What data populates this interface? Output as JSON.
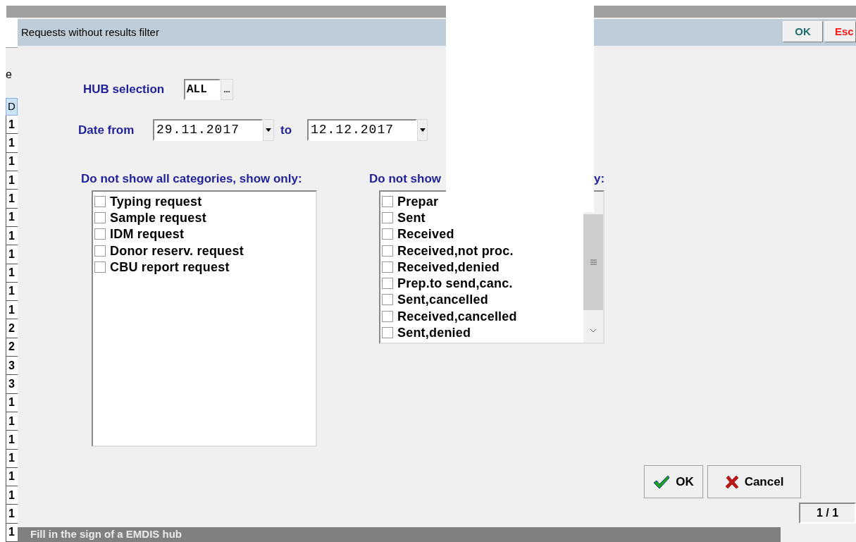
{
  "background": {
    "column_header_fragment": "e",
    "table_header": "D",
    "table_cells": [
      "1",
      "1",
      "1",
      "1",
      "1",
      "1",
      "1",
      "1",
      "1",
      "1",
      "1",
      "2",
      "2",
      "3",
      "3",
      "1",
      "1",
      "1",
      "1",
      "1",
      "1",
      "1",
      "1"
    ]
  },
  "window": {
    "title": "Requests without results filter",
    "title_buttons": [
      {
        "label": "OK",
        "kind": "ok"
      },
      {
        "label": "Esc",
        "kind": "esc"
      }
    ]
  },
  "hub": {
    "label": "HUB selection",
    "value": "ALL",
    "browse": "..."
  },
  "date": {
    "label": "Date from",
    "from": "29.11.2017",
    "to_label": "to",
    "to": "12.12.2017"
  },
  "categories": {
    "heading": "Do not show all categories, show only:",
    "items": [
      {
        "label": "Typing request",
        "checked": false
      },
      {
        "label": "Sample request",
        "checked": false
      },
      {
        "label": "IDM request",
        "checked": false
      },
      {
        "label": "Donor reserv. request",
        "checked": false
      },
      {
        "label": "CBU report request",
        "checked": false
      }
    ]
  },
  "statuses": {
    "heading_start": "Do not show",
    "heading_end": "y:",
    "items": [
      {
        "label": "Prepar",
        "checked": false
      },
      {
        "label": "Sent",
        "checked": false
      },
      {
        "label": "Received",
        "checked": false
      },
      {
        "label": "Received,not proc.",
        "checked": false
      },
      {
        "label": "Received,denied",
        "checked": false
      },
      {
        "label": "Prep.to send,canc.",
        "checked": false
      },
      {
        "label": "Sent,cancelled",
        "checked": false
      },
      {
        "label": "Received,cancelled",
        "checked": false
      },
      {
        "label": "Sent,denied",
        "checked": false
      }
    ]
  },
  "buttons": [
    {
      "label": "OK",
      "kind": "ok"
    },
    {
      "label": "Cancel",
      "kind": "cancel"
    }
  ],
  "pager": "1 / 1",
  "status_bar": "Fill in the sign of a EMDIS hub"
}
